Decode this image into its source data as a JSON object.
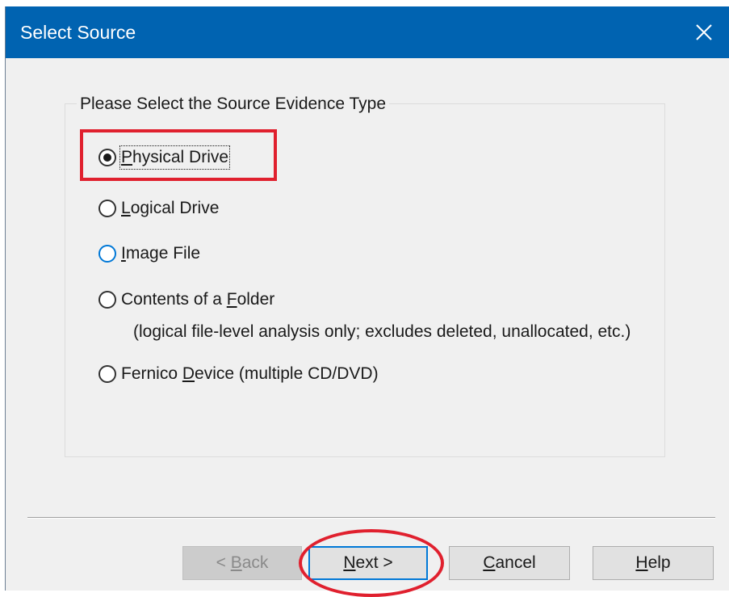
{
  "window": {
    "title": "Select Source",
    "close_icon": "close-icon"
  },
  "group": {
    "legend": "Please Select the Source Evidence Type"
  },
  "options": [
    {
      "pre": "",
      "accel": "P",
      "post": "hysical Drive",
      "checked": true
    },
    {
      "pre": "",
      "accel": "L",
      "post": "ogical Drive",
      "checked": false
    },
    {
      "pre": "",
      "accel": "I",
      "post": "mage File",
      "checked": false
    },
    {
      "pre": "Contents of a ",
      "accel": "F",
      "post": "older",
      "checked": false
    },
    {
      "pre": "Fernico ",
      "accel": "D",
      "post": "evice (multiple CD/DVD)",
      "checked": false
    }
  ],
  "folder_note": "(logical file-level analysis only; excludes deleted, unallocated, etc.)",
  "buttons": {
    "back": {
      "pre": "< ",
      "accel": "B",
      "post": "ack"
    },
    "next": {
      "pre": "",
      "accel": "N",
      "post": "ext >"
    },
    "cancel": {
      "pre": "",
      "accel": "C",
      "post": "ancel"
    },
    "help": {
      "pre": "",
      "accel": "H",
      "post": "elp"
    }
  },
  "colors": {
    "titlebar": "#0063b1",
    "annotation": "#e0202e",
    "focus": "#0078d7"
  }
}
